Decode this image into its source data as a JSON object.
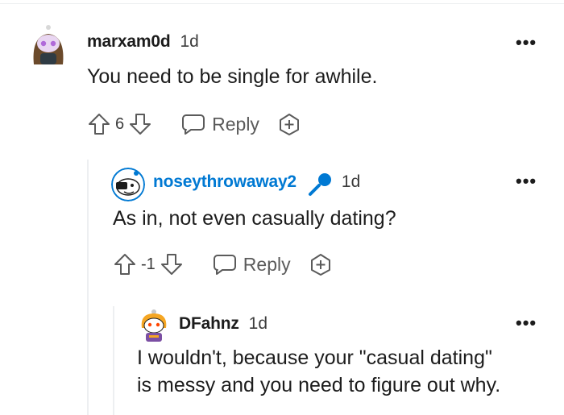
{
  "comments": [
    {
      "username": "marxam0d",
      "time": "1d",
      "text": "You need to be single for awhile.",
      "score": "6",
      "reply_label": "Reply",
      "more_label": "•••",
      "avatar_colors": {
        "bg": "#ffffff",
        "hair": "#6b4a2b",
        "face": "#c9a0dc"
      }
    },
    {
      "username": "noseythrowaway2",
      "username_color": "#0079d3",
      "time": "1d",
      "text": "As in, not even casually dating?",
      "score": "-1",
      "reply_label": "Reply",
      "more_label": "•••",
      "badge_icon": "microphone-icon",
      "badge_color": "#0079d3"
    },
    {
      "username": "DFahnz",
      "time": "1d",
      "text_lines": [
        "I wouldn't, because your \"casual dating\"",
        "is messy and you need to figure out why."
      ],
      "more_label": "•••",
      "avatar_colors": {
        "hair": "#f5a623",
        "shirt": "#7b4fa3"
      }
    }
  ],
  "colors": {
    "accent": "#0079d3",
    "text": "#1c1c1c",
    "muted": "#5b5b5b",
    "thread_line": "#edeff1"
  }
}
